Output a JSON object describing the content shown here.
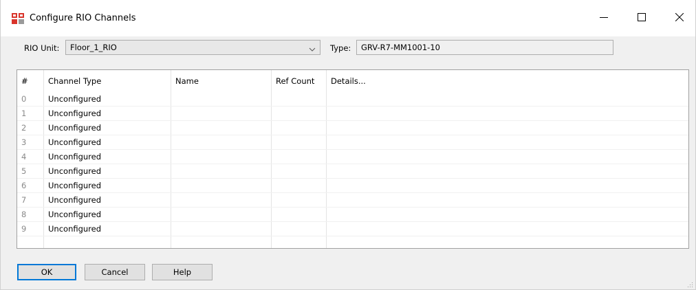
{
  "window": {
    "title": "Configure RIO Channels",
    "app_icon": "rio-config-icon",
    "controls": {
      "minimize": "minimize-icon",
      "maximize": "maximize-icon",
      "close": "close-icon"
    }
  },
  "form": {
    "rio_unit_label": "RIO Unit:",
    "rio_unit_value": "Floor_1_RIO",
    "type_label": "Type:",
    "type_value": "GRV-R7-MM1001-10"
  },
  "grid": {
    "columns": [
      "#",
      "Channel Type",
      "Name",
      "Ref Count",
      "Details..."
    ],
    "rows": [
      {
        "idx": "0",
        "channel_type": "Unconfigured",
        "name": "",
        "ref_count": "",
        "details": ""
      },
      {
        "idx": "1",
        "channel_type": "Unconfigured",
        "name": "",
        "ref_count": "",
        "details": ""
      },
      {
        "idx": "2",
        "channel_type": "Unconfigured",
        "name": "",
        "ref_count": "",
        "details": ""
      },
      {
        "idx": "3",
        "channel_type": "Unconfigured",
        "name": "",
        "ref_count": "",
        "details": ""
      },
      {
        "idx": "4",
        "channel_type": "Unconfigured",
        "name": "",
        "ref_count": "",
        "details": ""
      },
      {
        "idx": "5",
        "channel_type": "Unconfigured",
        "name": "",
        "ref_count": "",
        "details": ""
      },
      {
        "idx": "6",
        "channel_type": "Unconfigured",
        "name": "",
        "ref_count": "",
        "details": ""
      },
      {
        "idx": "7",
        "channel_type": "Unconfigured",
        "name": "",
        "ref_count": "",
        "details": ""
      },
      {
        "idx": "8",
        "channel_type": "Unconfigured",
        "name": "",
        "ref_count": "",
        "details": ""
      },
      {
        "idx": "9",
        "channel_type": "Unconfigured",
        "name": "",
        "ref_count": "",
        "details": ""
      },
      {
        "idx": "",
        "channel_type": "",
        "name": "",
        "ref_count": "",
        "details": ""
      }
    ]
  },
  "buttons": {
    "ok": "OK",
    "cancel": "Cancel",
    "help": "Help"
  },
  "colors": {
    "accent": "#0078d7",
    "icon_red": "#d9342b",
    "window_bg": "#f0f0f0"
  }
}
